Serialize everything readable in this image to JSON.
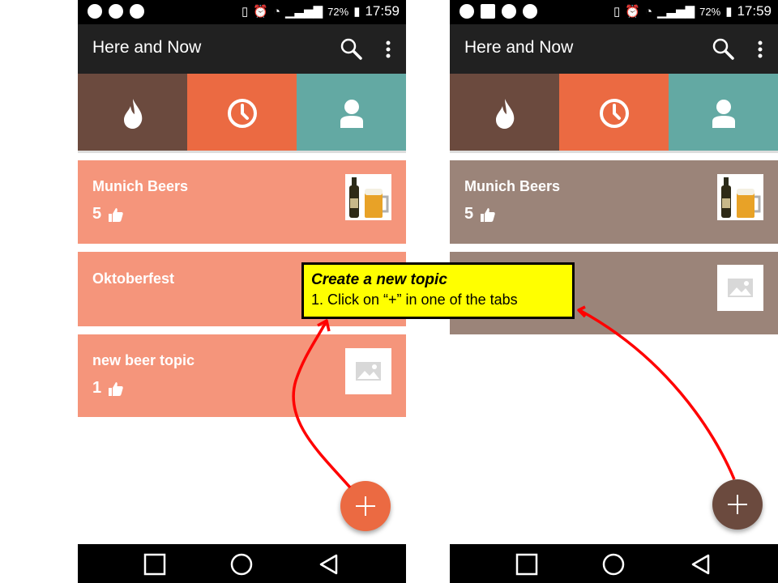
{
  "status_bar": {
    "battery_percent": "72%",
    "time": "17:59"
  },
  "app": {
    "title": "Here and Now"
  },
  "icons": {
    "search": "search-icon",
    "overflow": "more-vert-icon",
    "tab_hot": "flame-icon",
    "tab_recent": "clock-icon",
    "tab_profile": "person-icon",
    "like": "thumb-up-icon",
    "fab": "plus-icon"
  },
  "left_screen": {
    "tab_colors": [
      "#6b4a3e",
      "#eb6a42",
      "#63a9a3"
    ],
    "card_color": "#f5957b",
    "fab_color": "#eb6a42",
    "selected_tab": "recent",
    "topics": [
      {
        "title": "Munich Beers",
        "likes": "5",
        "image": "beer-bottle-and-mug-photo"
      },
      {
        "title": "Oktoberfest",
        "likes": "",
        "image": ""
      },
      {
        "title": "new beer topic",
        "likes": "1",
        "image": "image-placeholder-icon"
      }
    ]
  },
  "right_screen": {
    "tab_colors": [
      "#6b4a3e",
      "#eb6a42",
      "#63a9a3"
    ],
    "card_color": "#9b8479",
    "fab_color": "#6b4a3e",
    "selected_tab": "hot",
    "topics": [
      {
        "title": "Munich Beers",
        "likes": "5",
        "image": "beer-bottle-and-mug-photo"
      },
      {
        "title": "",
        "likes": "",
        "image": "image-placeholder-icon"
      }
    ]
  },
  "callout": {
    "title": "Create a new topic",
    "step": "1. Click on “+” in one of the tabs",
    "arrow_color": "#ff0000"
  },
  "nav_bar": {
    "buttons": [
      "recents",
      "home",
      "back"
    ]
  }
}
